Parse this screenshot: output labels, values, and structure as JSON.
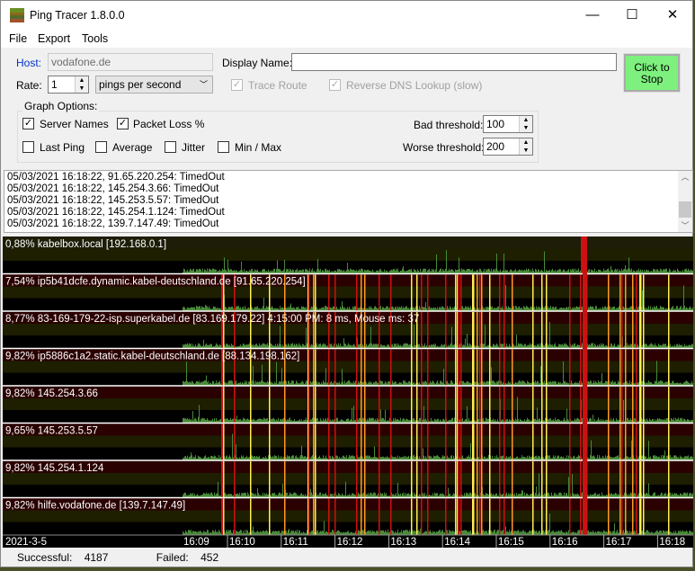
{
  "window": {
    "title": "Ping Tracer 1.8.0.0",
    "minimize": "—",
    "maximize": "☐",
    "close": "✕"
  },
  "menu": [
    "File",
    "Export",
    "Tools"
  ],
  "controls": {
    "host_label": "Host:",
    "host_value": "vodafone.de",
    "display_name_label": "Display Name:",
    "display_name_value": "",
    "rate_label": "Rate:",
    "rate_value": "1",
    "rate_unit": "pings per second",
    "trace_route": {
      "label": "Trace Route",
      "checked": true,
      "enabled": false
    },
    "reverse_dns": {
      "label": "Reverse DNS Lookup (slow)",
      "checked": true,
      "enabled": false
    },
    "stop_button": "Click to Stop",
    "host_label_color": "#0033cc",
    "stop_button_color": "#7ef07e"
  },
  "graph_options": {
    "title": "Graph Options:",
    "checkboxes": [
      {
        "label": "Server Names",
        "checked": true
      },
      {
        "label": "Packet Loss %",
        "checked": true
      },
      {
        "label": "Last Ping",
        "checked": false
      },
      {
        "label": "Average",
        "checked": false
      },
      {
        "label": "Jitter",
        "checked": false
      },
      {
        "label": "Min / Max",
        "checked": false
      }
    ],
    "bad_threshold_label": "Bad threshold:",
    "bad_threshold": "100",
    "worse_threshold_label": "Worse threshold:",
    "worse_threshold": "200"
  },
  "log": [
    "05/03/2021 16:18:22, 91.65.220.254: TimedOut",
    "05/03/2021 16:18:22, 145.254.3.66: TimedOut",
    "05/03/2021 16:18:22, 145.253.5.57: TimedOut",
    "05/03/2021 16:18:22, 145.254.1.124: TimedOut",
    "05/03/2021 16:18:22, 139.7.147.49: TimedOut"
  ],
  "graphs": [
    {
      "label": "0,88% kabelbox.local [192.168.0.1]",
      "loss": 0.88
    },
    {
      "label": "7,54% ip5b41dcfe.dynamic.kabel-deutschland.de [91.65.220.254]",
      "loss": 7.54
    },
    {
      "label": "8,77% 83-169-179-22-isp.superkabel.de [83.169.179.22]  4:15:00 PM: 8 ms, Mouse ms: 37",
      "loss": 8.77
    },
    {
      "label": "9,82% ip5886c1a2.static.kabel-deutschland.de [88.134.198.162]",
      "loss": 9.82
    },
    {
      "label": "9,82% 145.254.3.66",
      "loss": 9.82
    },
    {
      "label": "9,65% 145.253.5.57",
      "loss": 9.65
    },
    {
      "label": "9,82% 145.254.1.124",
      "loss": 9.82
    },
    {
      "label": "9,82% hilfe.vodafone.de [139.7.147.49]",
      "loss": 9.82
    }
  ],
  "time_axis": {
    "date": "2021-3-5",
    "ticks": [
      "16:09",
      "16:10",
      "16:11",
      "16:12",
      "16:13",
      "16:14",
      "16:15",
      "16:16",
      "16:17",
      "16:18"
    ]
  },
  "colors": {
    "ping_bar": "#4a8a3a",
    "timeout": "#cc1111",
    "bad": "#ffee55",
    "worse": "#ff9922"
  },
  "status": {
    "successful_label": "Successful:",
    "successful": "4187",
    "failed_label": "Failed:",
    "failed": "452"
  }
}
